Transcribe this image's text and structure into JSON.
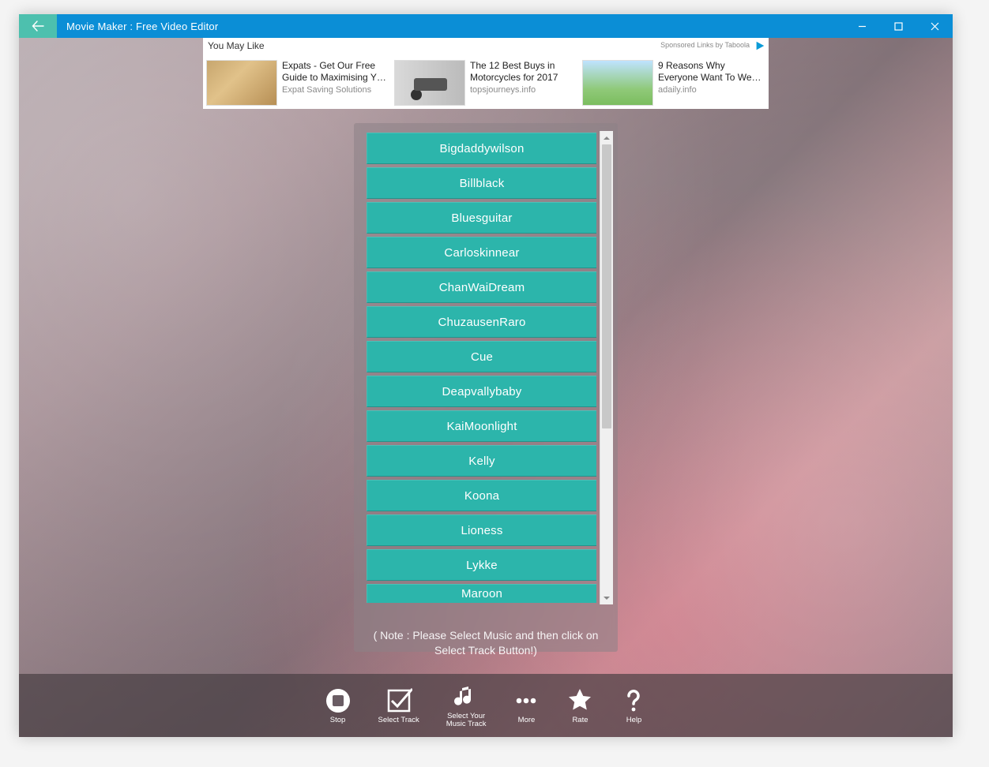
{
  "titlebar": {
    "title": "Movie Maker : Free Video Editor"
  },
  "ad": {
    "header": "You May Like",
    "sponsor_text": "Sponsored Links by Taboola",
    "items": [
      {
        "title": "Expats - Get Our Free Guide to Maximising Y…",
        "source": "Expat Saving Solutions"
      },
      {
        "title": "The 12 Best Buys in Motorcycles for 2017",
        "source": "topsjourneys.info"
      },
      {
        "title": "9 Reasons Why Everyone Want To We…",
        "source": "adaily.info"
      }
    ]
  },
  "tracks": [
    "Bigdaddywilson",
    "Billblack",
    "Bluesguitar",
    "Carloskinnear",
    "ChanWaiDream",
    "ChuzausenRaro",
    "Cue",
    "Deapvallybaby",
    "KaiMoonlight",
    "Kelly",
    "Koona",
    "Lioness",
    "Lykke",
    "Maroon"
  ],
  "note": "( Note : Please Select Music and then click on Select Track Button!)",
  "bottom": [
    {
      "label": "Stop",
      "icon": "stop-icon"
    },
    {
      "label": "Select Track",
      "icon": "check-icon"
    },
    {
      "label": "Select Your\nMusic Track",
      "icon": "music-icon"
    },
    {
      "label": "More",
      "icon": "more-icon"
    },
    {
      "label": "Rate",
      "icon": "star-icon"
    },
    {
      "label": "Help",
      "icon": "help-icon"
    }
  ]
}
